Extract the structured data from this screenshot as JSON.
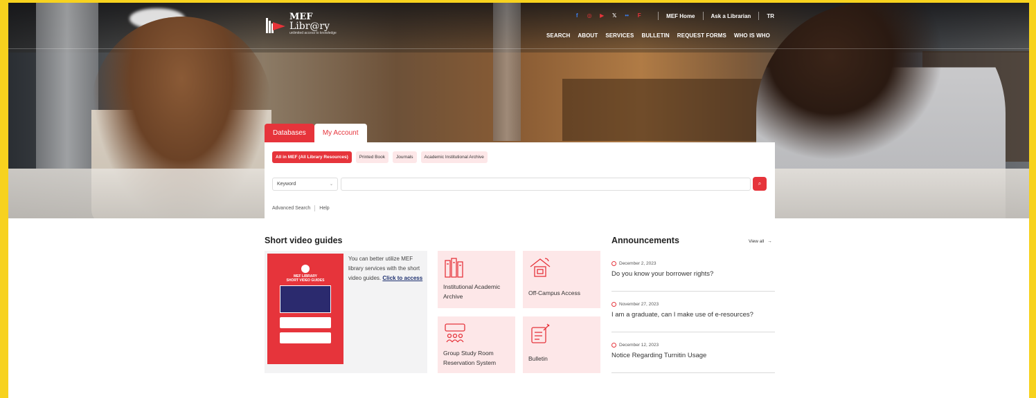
{
  "header": {
    "logo_line1": "MEF",
    "logo_line2": "Libr@ry",
    "logo_tagline": "unlimited access to knowledge",
    "social_icons": [
      "facebook-icon",
      "instagram-icon",
      "youtube-icon",
      "x-icon",
      "flickr-icon",
      "foursquare-icon"
    ],
    "links": [
      "MEF Home",
      "Ask a Librarian",
      "TR"
    ],
    "nav": [
      "SEARCH",
      "ABOUT",
      "SERVICES",
      "BULLETIN",
      "REQUEST FORMS",
      "WHO IS WHO"
    ]
  },
  "search": {
    "tabs": [
      "Databases",
      "My Account"
    ],
    "filters": [
      "All in MEF (All Library Resources)",
      "Printed Book",
      "Journals",
      "Academic Institutional Archive"
    ],
    "field_select": "Keyword",
    "links": [
      "Advanced Search",
      "Help"
    ]
  },
  "videos": {
    "title": "Short video guides",
    "poster_title": "MEF LIBRARY\nSHORT VIDEO GUIDES",
    "text": "You can better utilize MEF library services with the short video guides.",
    "link": "Click to access"
  },
  "tiles": [
    {
      "label": "Institutional Academic Archive",
      "icon": "archive-icon"
    },
    {
      "label": "Off-Campus Access",
      "icon": "remote-access-icon"
    },
    {
      "label": "Group Study Room Reservation System",
      "icon": "study-room-icon"
    },
    {
      "label": "Bulletin",
      "icon": "bulletin-icon"
    }
  ],
  "announcements": {
    "title": "Announcements",
    "view_all": "View all",
    "items": [
      {
        "date": "December 2, 2023",
        "title": "Do you know your borrower rights?"
      },
      {
        "date": "November 27, 2023",
        "title": "I am a graduate, can I make use of e-resources?"
      },
      {
        "date": "December 12, 2023",
        "title": "Notice Regarding Turnitin Usage"
      }
    ]
  },
  "colors": {
    "accent": "#e6343b",
    "tile_bg": "#fde7e8",
    "frame_bg": "#f7d21e",
    "link": "#1d2f6f"
  }
}
